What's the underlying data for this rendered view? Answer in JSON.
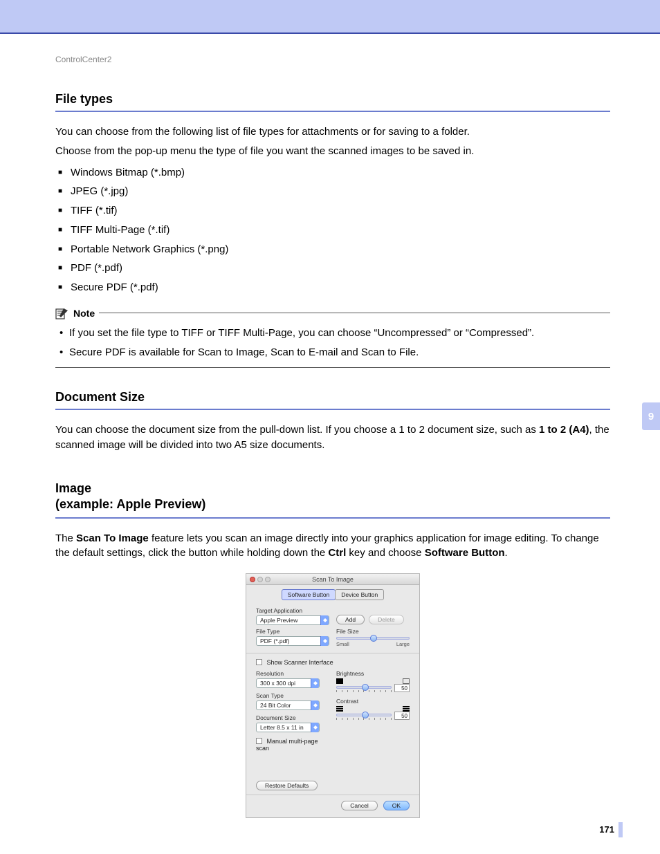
{
  "running_head": "ControlCenter2",
  "chapter_tab": "9",
  "page_number": "171",
  "section1": {
    "title": "File types",
    "p1": "You can choose from the following list of file types for attachments or for saving to a folder.",
    "p2": "Choose from the pop-up menu the type of file you want the scanned images to be saved in.",
    "items": [
      "Windows Bitmap (*.bmp)",
      "JPEG (*.jpg)",
      "TIFF (*.tif)",
      "TIFF Multi-Page (*.tif)",
      "Portable Network Graphics (*.png)",
      "PDF (*.pdf)",
      "Secure PDF (*.pdf)"
    ]
  },
  "note": {
    "label": "Note",
    "items": [
      "If you set the file type to TIFF or TIFF Multi-Page, you can choose “Uncompressed” or “Compressed”.",
      "Secure PDF is available for Scan to Image, Scan to E-mail and Scan to File."
    ]
  },
  "section2": {
    "title": "Document Size",
    "p1_a": "You can choose the document size from the pull-down list. If you choose a 1 to 2 document size, such as ",
    "p1_b": "1 to 2 (A4)",
    "p1_c": ", the scanned image will be divided into two A5 size documents."
  },
  "section3": {
    "title_l1": "Image",
    "title_l2": "(example: Apple Preview)",
    "p1_a": "The ",
    "p1_b": "Scan To Image",
    "p1_c": " feature lets you scan an image directly into your graphics application for image editing. To change the default settings, click the button while holding down the ",
    "p1_d": "Ctrl",
    "p1_e": " key and choose ",
    "p1_f": "Software Button",
    "p1_g": "."
  },
  "dialog": {
    "title": "Scan To Image",
    "tabs": {
      "software": "Software Button",
      "device": "Device Button"
    },
    "labels": {
      "target_app": "Target Application",
      "file_type": "File Type",
      "file_size": "File Size",
      "small": "Small",
      "large": "Large",
      "show_scanner": "Show Scanner Interface",
      "resolution": "Resolution",
      "scan_type": "Scan Type",
      "document_size": "Document Size",
      "manual_multi": "Manual multi-page scan",
      "brightness": "Brightness",
      "contrast": "Contrast"
    },
    "values": {
      "target_app": "Apple Preview",
      "file_type": "PDF (*.pdf)",
      "resolution": "300 x 300 dpi",
      "scan_type": "24 Bit Color",
      "document_size": "Letter  8.5 x 11 in",
      "brightness": "50",
      "contrast": "50"
    },
    "buttons": {
      "add": "Add",
      "delete": "Delete",
      "restore": "Restore Defaults",
      "cancel": "Cancel",
      "ok": "OK"
    }
  }
}
